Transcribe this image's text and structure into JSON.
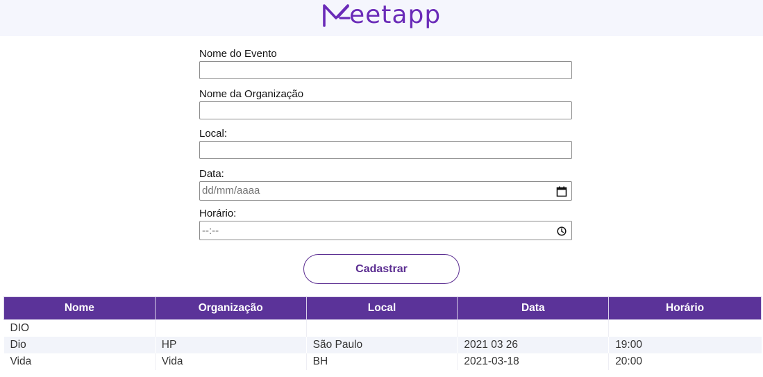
{
  "brand": {
    "name": "eetapp",
    "color": "#6a2bb8"
  },
  "form": {
    "fields": [
      {
        "label": "Nome do Evento",
        "value": ""
      },
      {
        "label": "Nome da Organização",
        "value": ""
      },
      {
        "label": "Local:",
        "value": ""
      },
      {
        "label": "Data:",
        "placeholder": "dd/mm/aaaa",
        "icon": "calendar-icon"
      },
      {
        "label": "Horário:",
        "placeholder": "--:--",
        "icon": "clock-icon"
      }
    ],
    "submit_label": "Cadastrar"
  },
  "table": {
    "headers": [
      "Nome",
      "Organização",
      "Local",
      "Data",
      "Horário"
    ],
    "rows": [
      [
        "DIO",
        "",
        "",
        "",
        ""
      ],
      [
        "Dio",
        "HP",
        "São Paulo",
        "2021 03 26",
        "19:00"
      ],
      [
        "Vida",
        "Vida",
        "BH",
        "2021-03-18",
        "20:00"
      ]
    ]
  },
  "colors": {
    "accent": "#5b3399",
    "header_bg": "#f5f6fd"
  }
}
